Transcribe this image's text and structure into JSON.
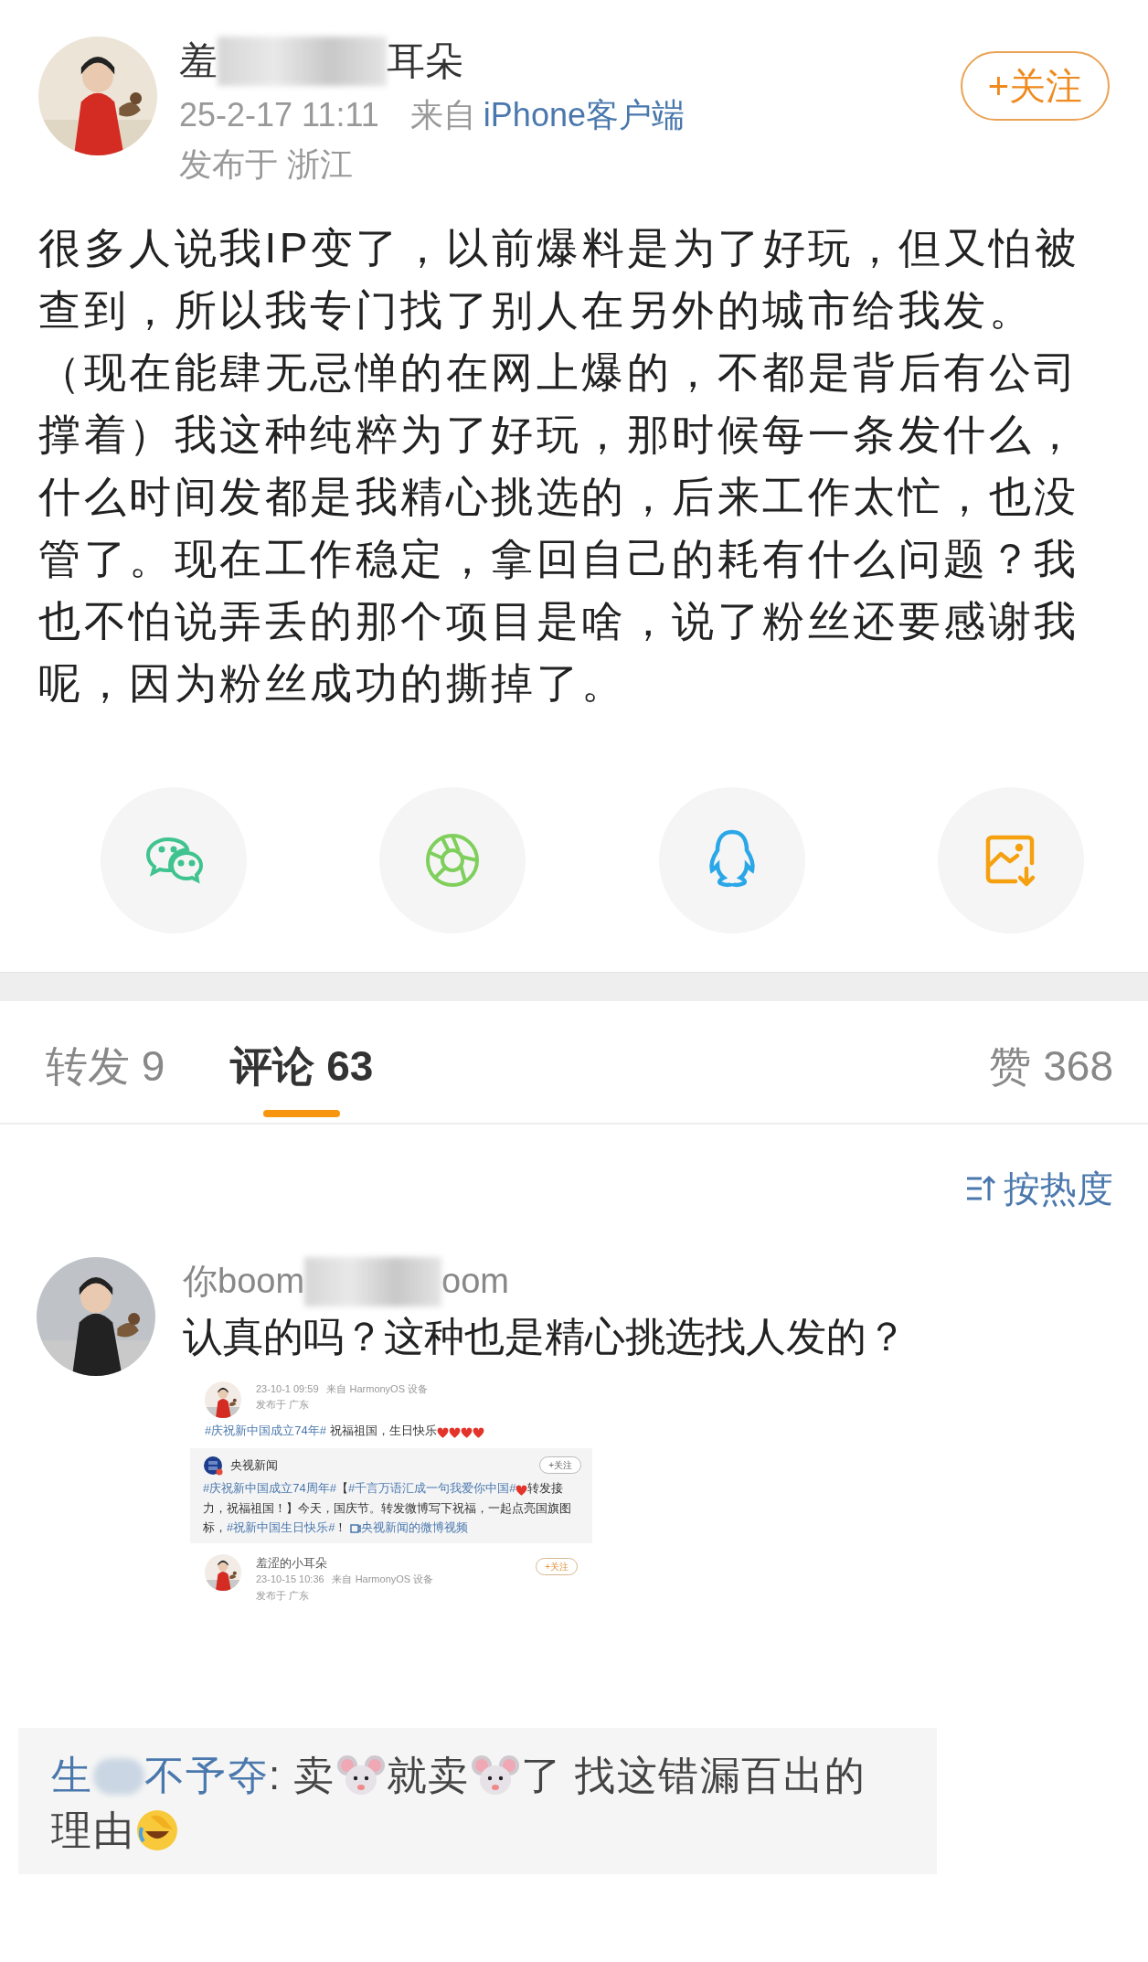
{
  "post": {
    "author": {
      "name_start": "羞",
      "name_end": "耳朵"
    },
    "follow_button": "+关注",
    "time": "25-2-17 11:11",
    "source_prefix": "来自",
    "source": "iPhone客户端",
    "location": "发布于 浙江",
    "text": "很多人说我IP变了，以前爆料是为了好玩，但又怕被查到，所以我专门找了别人在另外的城市给我发。（现在能肆无忌惮的在网上爆的，不都是背后有公司撑着）我这种纯粹为了好玩，那时候每一条发什么，什么时间发都是我精心挑选的，后来工作太忙，也没管了。现在工作稳定，拿回自己的耗有什么问题？我也不怕说弄丢的那个项目是啥，说了粉丝还要感谢我呢，因为粉丝成功的撕掉了。"
  },
  "share_buttons": [
    {
      "kind": "wechat"
    },
    {
      "kind": "moments"
    },
    {
      "kind": "qq"
    },
    {
      "kind": "save-image"
    }
  ],
  "tabs": [
    {
      "label": "转发 9",
      "selected": false
    },
    {
      "label": "评论 63",
      "selected": true
    },
    {
      "label": "赞 368",
      "selected": false
    }
  ],
  "sort": {
    "label": "按热度"
  },
  "comments": [
    {
      "author": {
        "name_start": "你boom",
        "name_end": "oom"
      },
      "text": "认真的吗？这种也是精心挑选找人发的？",
      "screenshot": {
        "post_1": {
          "time": "23-10-1 09:59",
          "source_prefix": "来自",
          "source": "HarmonyOS 设备",
          "location": "发布于 广东",
          "content": [
            {
              "kind": "tag",
              "text": "#庆祝新中国成立74年#"
            },
            {
              "kind": "text",
              "text": " 祝福祖国，生日快乐"
            },
            {
              "kind": "heart"
            },
            {
              "kind": "heart"
            },
            {
              "kind": "heart"
            },
            {
              "kind": "heart"
            }
          ]
        },
        "repost": {
          "author": "央视新闻",
          "follow_button": "+关注",
          "content": [
            {
              "kind": "tag",
              "text": "#庆祝新中国成立74周年#"
            },
            {
              "kind": "text",
              "text": "【"
            },
            {
              "kind": "tag",
              "text": "#千言万语汇成一句我爱你中国#"
            },
            {
              "kind": "heart"
            },
            {
              "kind": "text",
              "text": "转发接力，祝福祖国！】今天，国庆节。转发微博写下祝福，一起点亮国旗图标，"
            },
            {
              "kind": "tag",
              "text": "#祝新中国生日快乐#"
            },
            {
              "kind": "text",
              "text": "！ "
            },
            {
              "kind": "video"
            },
            {
              "kind": "tag",
              "text": "央视新闻的微博视频"
            }
          ]
        },
        "post_2": {
          "author": "羞涩的小耳朵",
          "follow_button": "+关注",
          "time": "23-10-15 10:36",
          "source_prefix": "来自",
          "source": "HarmonyOS 设备",
          "location": "发布于 广东"
        }
      },
      "reply": {
        "author_start": "生",
        "author_end": "不予夺",
        "content": [
          {
            "kind": "text",
            "text": ": 卖"
          },
          {
            "kind": "mouse"
          },
          {
            "kind": "text",
            "text": "就卖"
          },
          {
            "kind": "mouse"
          },
          {
            "kind": "text",
            "text": "了  找这错漏百出的理由"
          },
          {
            "kind": "laugh"
          }
        ]
      }
    }
  ]
}
